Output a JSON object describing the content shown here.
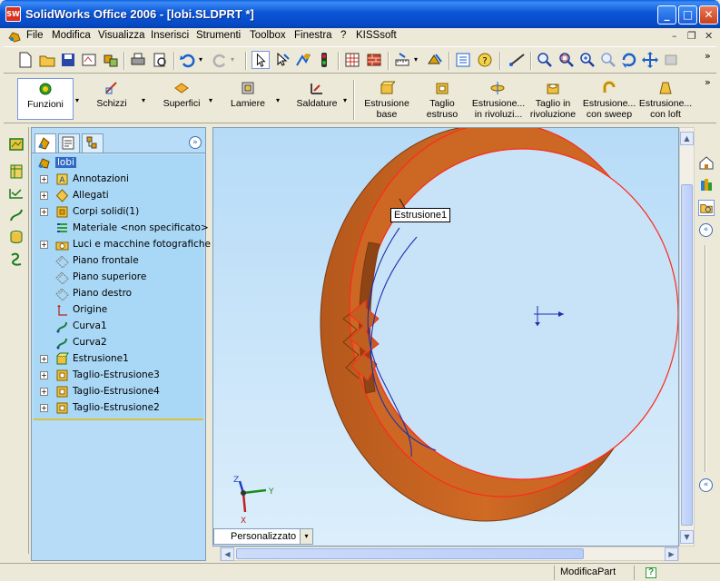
{
  "window": {
    "title": "SolidWorks Office 2006 - [lobi.SLDPRT *]",
    "app_icon": "solidworks-logo-icon",
    "controls": [
      "minimize",
      "maximize",
      "close"
    ]
  },
  "menubar": {
    "items": [
      "File",
      "Modifica",
      "Visualizza",
      "Inserisci",
      "Strumenti",
      "Toolbox",
      "Finestra",
      "?",
      "KISSsoft"
    ]
  },
  "command_manager": {
    "items": [
      {
        "label": "Funzioni",
        "icon": "features-icon"
      },
      {
        "label": "Schizzi",
        "icon": "sketch-icon"
      },
      {
        "label": "Superfici",
        "icon": "surfaces-icon"
      },
      {
        "label": "Lamiere",
        "icon": "sheetmetal-icon"
      },
      {
        "label": "Saldature",
        "icon": "weldments-icon"
      },
      {
        "label": "Estrusione base",
        "icon": "extrude-boss-icon"
      },
      {
        "label": "Taglio estruso",
        "icon": "extruded-cut-icon"
      },
      {
        "label": "Estrusione... in rivoluzi...",
        "icon": "revolve-boss-icon"
      },
      {
        "label": "Taglio in rivoluzione",
        "icon": "revolved-cut-icon"
      },
      {
        "label": "Estrusione... con sweep",
        "icon": "sweep-icon"
      },
      {
        "label": "Estrusione... con loft",
        "icon": "loft-icon"
      }
    ]
  },
  "feature_tree": {
    "root": "lobi",
    "nodes": [
      {
        "label": "Annotazioni",
        "icon": "annotations-icon",
        "expandable": true
      },
      {
        "label": "Allegati",
        "icon": "attachments-icon",
        "expandable": true
      },
      {
        "label": "Corpi solidi(1)",
        "icon": "solid-bodies-icon",
        "expandable": true
      },
      {
        "label": "Materiale <non specificato>",
        "icon": "material-icon",
        "expandable": false
      },
      {
        "label": "Luci e macchine fotografiche",
        "icon": "lights-cameras-icon",
        "expandable": true
      },
      {
        "label": "Piano frontale",
        "icon": "plane-icon",
        "expandable": false
      },
      {
        "label": "Piano superiore",
        "icon": "plane-icon",
        "expandable": false
      },
      {
        "label": "Piano destro",
        "icon": "plane-icon",
        "expandable": false
      },
      {
        "label": "Origine",
        "icon": "origin-icon",
        "expandable": false
      },
      {
        "label": "Curva1",
        "icon": "curve-icon",
        "expandable": false
      },
      {
        "label": "Curva2",
        "icon": "curve-icon",
        "expandable": false
      },
      {
        "label": "Estrusione1",
        "icon": "extrude-feature-icon",
        "expandable": true
      },
      {
        "label": "Taglio-Estrusione3",
        "icon": "cut-feature-icon",
        "expandable": true
      },
      {
        "label": "Taglio-Estrusione4",
        "icon": "cut-feature-icon",
        "expandable": true
      },
      {
        "label": "Taglio-Estrusione2",
        "icon": "cut-feature-icon",
        "expandable": true
      }
    ]
  },
  "graphics": {
    "tooltip": "Estrusione1",
    "view_orientation": "Personalizzato",
    "triad": {
      "x": "X",
      "y": "Y",
      "z": "Z"
    },
    "part_color": "#c8611f",
    "edge_color": "#ff2a1a",
    "curve_color": "#1c2fb0"
  },
  "statusbar": {
    "mode": "ModificaPart",
    "help": "?"
  }
}
